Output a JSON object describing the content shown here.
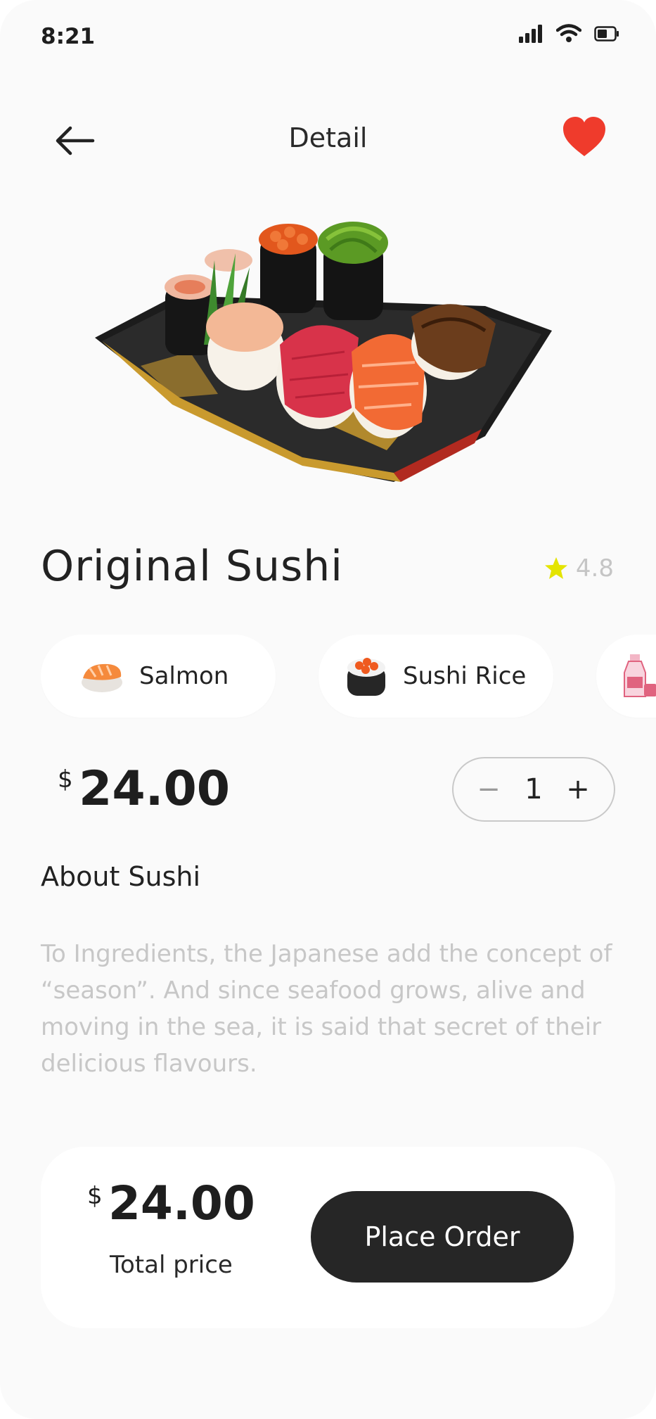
{
  "status_bar": {
    "time": "8:21"
  },
  "header": {
    "title": "Detail"
  },
  "product": {
    "name": "Original Sushi",
    "rating": "4.8"
  },
  "ingredients": [
    {
      "label": "Salmon",
      "icon": "salmon-icon"
    },
    {
      "label": "Sushi Rice",
      "icon": "sushi-roll-icon"
    },
    {
      "label": "",
      "icon": "sake-icon"
    }
  ],
  "price": {
    "currency": "$",
    "amount": "24.00"
  },
  "quantity": {
    "minus": "−",
    "value": "1",
    "plus": "+"
  },
  "about": {
    "heading": "About Sushi",
    "text": "To Ingredients, the Japanese add the concept of “season”. And since seafood grows, alive and moving in the sea, it is said that secret of their delicious flavours."
  },
  "order": {
    "currency": "$",
    "total": "24.00",
    "total_label": "Total price",
    "button": "Place Order"
  },
  "colors": {
    "accent_dark": "#262626",
    "heart": "#ef3b2c",
    "star": "#e4e400",
    "muted": "#c7c7c7"
  }
}
